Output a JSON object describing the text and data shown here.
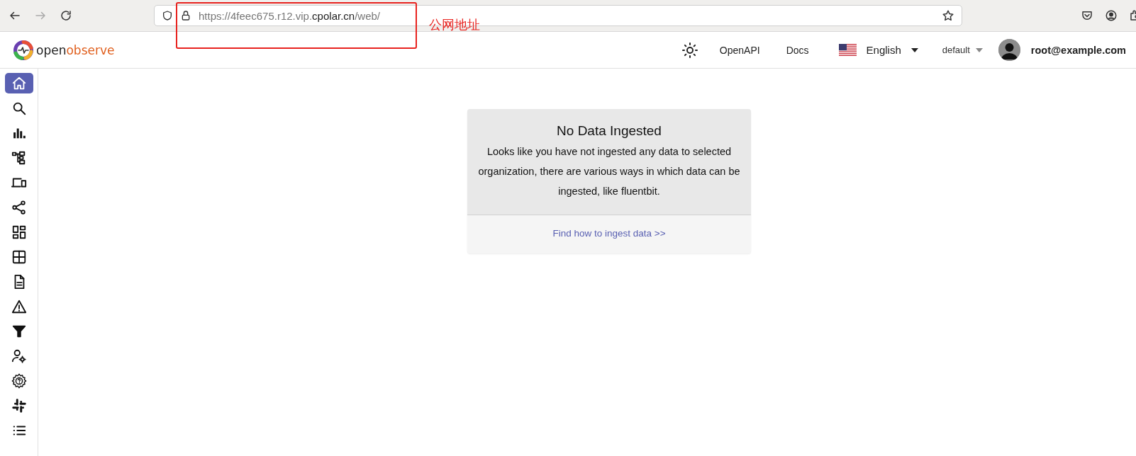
{
  "browser": {
    "url": {
      "before": "https://4feec675.r12.vip.",
      "domain": "cpolar.cn",
      "after": "/web/"
    }
  },
  "annotation": {
    "label": "公网地址"
  },
  "header": {
    "logo": {
      "part1": "open",
      "part2": "observe"
    },
    "links": [
      "OpenAPI",
      "Docs"
    ],
    "language": "English",
    "organization": "default",
    "user": "root@example.com"
  },
  "sidebar": {
    "items": [
      {
        "selected": true
      },
      {
        "selected": false
      },
      {
        "selected": false
      },
      {
        "selected": false
      },
      {
        "selected": false
      },
      {
        "selected": false
      },
      {
        "selected": false
      },
      {
        "selected": false
      },
      {
        "selected": false
      },
      {
        "selected": false
      },
      {
        "selected": false
      },
      {
        "selected": false
      },
      {
        "selected": false
      },
      {
        "selected": false
      },
      {
        "selected": false
      }
    ]
  },
  "card": {
    "title": "No Data Ingested",
    "message": "Looks like you have not ingested any data to selected organization, there are various ways in which data can be ingested, like fluentbit.",
    "link": "Find how to ingest data >>"
  }
}
